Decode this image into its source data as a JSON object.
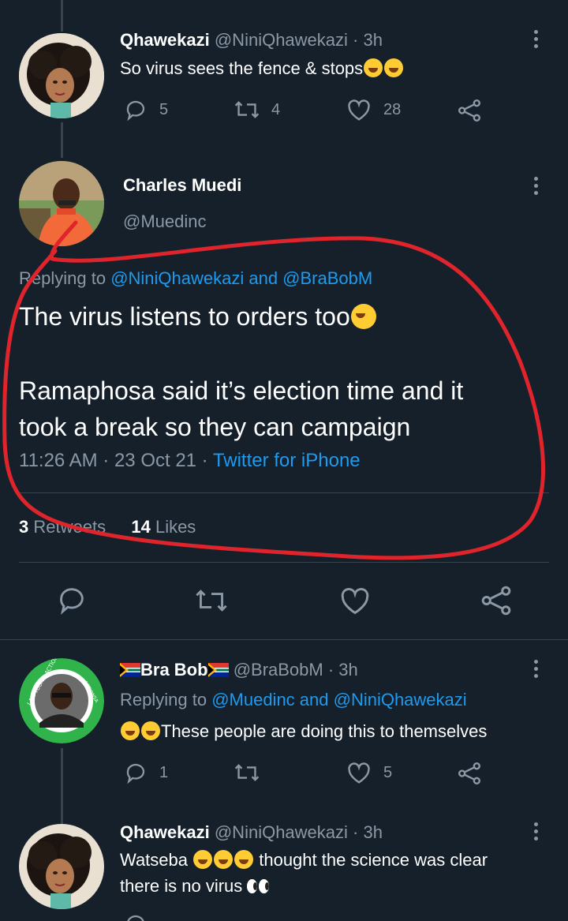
{
  "tweets": {
    "t1": {
      "name": "Qhawekazi",
      "handle": "@NiniQhawekazi",
      "time": "· 3h",
      "text": "So virus sees the fence & stops",
      "replies": "5",
      "retweets": "4",
      "likes": "28"
    },
    "main": {
      "name": "Charles Muedi",
      "handle": "@Muedinc",
      "replying_prefix": "Replying to ",
      "replying_to": "@NiniQhawekazi and @BraBobM",
      "text_line1": "The virus listens to orders too",
      "text_line2": "Ramaphosa said it’s election time and it",
      "text_line3": "took a break so they can campaign",
      "timestamp": "11:26 AM · 23 Oct 21 · ",
      "source": "Twitter for iPhone",
      "retweets_count": "3",
      "retweets_label": "Retweets",
      "likes_count": "14",
      "likes_label": "Likes"
    },
    "t3": {
      "name": "Bra Bob",
      "handle": "@BraBobM",
      "time": "· 3h",
      "replying_prefix": "Replying to ",
      "replying_to": "@Muedinc and @NiniQhawekazi",
      "text": "These people are doing this to themselves",
      "avatar_ring_text_left": "I AM YOUNG ACTIONSA",
      "avatar_ring_text_right": "ACTIONSA",
      "replies": "1",
      "likes": "5"
    },
    "t4": {
      "name": "Qhawekazi",
      "handle": "@NiniQhawekazi",
      "time": "· 3h",
      "text_line1_a": "Watseba ",
      "text_line1_b": " thought the science was clear",
      "text_line2": "there is no virus "
    }
  },
  "icons": [
    "reply-icon",
    "retweet-icon",
    "like-icon",
    "share-icon",
    "more-icon"
  ],
  "colors": {
    "background": "#15202b",
    "link": "#1d9bf0",
    "muted": "#8b98a5",
    "annotation": "#e0242b"
  }
}
